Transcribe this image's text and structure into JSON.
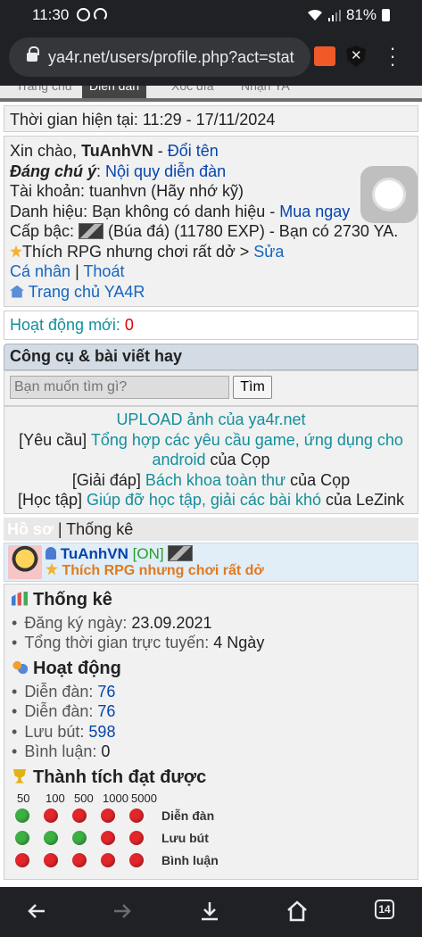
{
  "status_bar": {
    "time": "11:30",
    "battery": "81%"
  },
  "browser": {
    "url": "ya4r.net/users/profile.php?act=stat",
    "tab_count": "14"
  },
  "top_tabs": [
    "Trang chủ",
    "Diễn đàn",
    "Xóc đĩa",
    "Nhận YA"
  ],
  "time_line": "Thời gian hiện tại: 11:29 - 17/11/2024",
  "greeting": {
    "hello": "Xin chào, ",
    "username": "TuAnhVN",
    "sep": " - ",
    "rename": "Đổi tên",
    "note_label": "Đáng chú ý",
    "note_colon": ": ",
    "rules": "Nội quy diễn đàn",
    "account": "Tài khoản: tuanhvn (Hãy nhớ kỹ)",
    "title_prefix": "Danh hiệu: Bạn không có danh hiệu - ",
    "buy_now": "Mua ngay",
    "level_prefix": "Cấp bậc: ",
    "level_text": " (Búa đá) (11780 EXP) - Bạn có 2730 YA.",
    "status_text": "Thích RPG nhưng chơi rất dở > ",
    "edit": "Sửa",
    "personal": "Cá nhân",
    "pipe": " | ",
    "logout": "Thoát",
    "home": "Trang chủ YA4R"
  },
  "activity": {
    "label": "Hoạt động mới: ",
    "count": "0"
  },
  "tools": {
    "heading": "Công cụ & bài viết hay",
    "search_placeholder": "Bạn muốn tìm gì?",
    "search_button": "Tìm"
  },
  "featured": {
    "upload": "UPLOAD ảnh của ya4r.net",
    "req_tag": "[Yêu cầu] ",
    "req_link": "Tổng hợp các yêu cầu game, ứng dụng cho android",
    "req_by": " của Cọp",
    "faq_tag": "[Giải đáp] ",
    "faq_link": "Bách khoa toàn thư",
    "faq_by": " của Cọp",
    "study_tag": "[Học tập] ",
    "study_link": "Giúp đỡ học tập, giải các bài khó",
    "study_by": " của LeZink"
  },
  "profile_tabs": {
    "active": "Hồ sơ",
    "pipe": " | ",
    "other": "Thống kê"
  },
  "user_card": {
    "name": "TuAnhVN",
    "online": "[ON]",
    "status": "Thích RPG nhưng chơi rất dở"
  },
  "stats": {
    "heading": "Thống kê",
    "reg_label": "Đăng ký ngày: ",
    "reg_value": "23.09.2021",
    "online_label": "Tổng thời gian trực tuyến: ",
    "online_value": "4 Ngày"
  },
  "activity_section": {
    "heading": "Hoạt động",
    "forum1_label": "Diễn đàn: ",
    "forum1_value": "76",
    "forum2_label": "Diễn đàn: ",
    "forum2_value": "76",
    "guestbook_label": "Lưu bút: ",
    "guestbook_value": "598",
    "comment_label": "Bình luận: ",
    "comment_value": "0"
  },
  "achievements": {
    "heading": "Thành tích đạt được",
    "thresholds": [
      "50",
      "100",
      "500",
      "1000",
      "5000"
    ],
    "rows": [
      {
        "label": "Diễn đàn",
        "achieved": [
          true,
          false,
          false,
          false,
          false
        ]
      },
      {
        "label": "Lưu bút",
        "achieved": [
          true,
          true,
          true,
          false,
          false
        ]
      },
      {
        "label": "Bình luận",
        "achieved": [
          false,
          false,
          false,
          false,
          false
        ]
      }
    ]
  },
  "colors": {
    "link": "#0645ad",
    "teal_link": "#138f9b",
    "red": "#e00000",
    "achieved": "#3cb044",
    "not_achieved": "#e2262b"
  }
}
